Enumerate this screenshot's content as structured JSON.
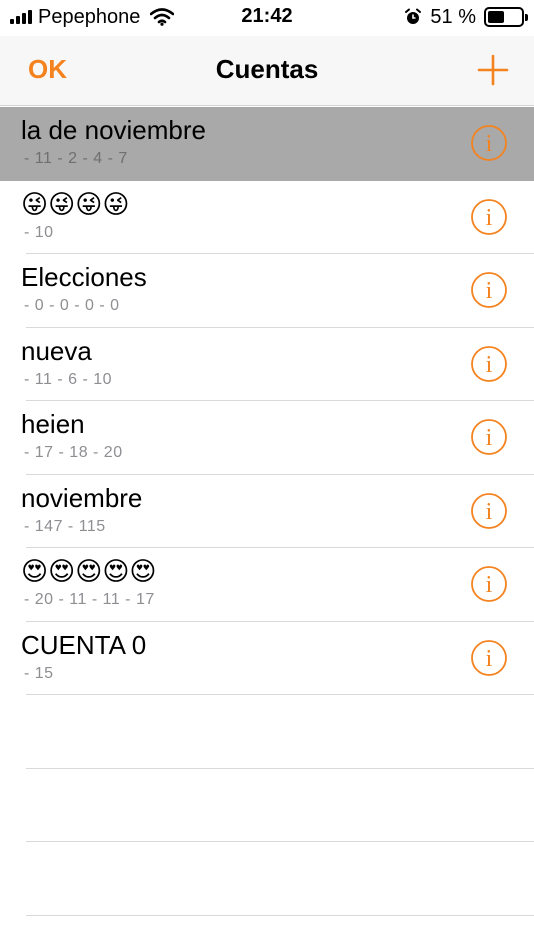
{
  "status_bar": {
    "carrier": "Pepephone",
    "time": "21:42",
    "battery_text": "51 %",
    "battery_level": 0.51,
    "icons": [
      "signal-icon",
      "wifi-icon",
      "alarm-icon",
      "battery-icon"
    ]
  },
  "nav": {
    "left_label": "OK",
    "title": "Cuentas",
    "right_icon": "plus-icon"
  },
  "colors": {
    "accent": "#f4831f",
    "selected_row": "#a9a9a9",
    "subtitle": "#8e8e93"
  },
  "accounts": [
    {
      "title": "la de noviembre",
      "subtitle": "- 11  - 2  - 4  - 7",
      "selected": true
    },
    {
      "title": "😜😜😜😜",
      "subtitle": "- 10",
      "selected": false
    },
    {
      "title": "Elecciones",
      "subtitle": "- 0  - 0  - 0  - 0",
      "selected": false
    },
    {
      "title": "nueva",
      "subtitle": "- 11  - 6  - 10",
      "selected": false
    },
    {
      "title": "heien",
      "subtitle": "- 17  - 18  - 20",
      "selected": false
    },
    {
      "title": "noviembre",
      "subtitle": "- 147  - 115",
      "selected": false
    },
    {
      "title": "😍😍😍😍😍",
      "subtitle": "- 20  - 11  - 11  - 17",
      "selected": false
    },
    {
      "title": "CUENTA 0",
      "subtitle": "- 15",
      "selected": false
    }
  ],
  "row_icon": "info-icon"
}
